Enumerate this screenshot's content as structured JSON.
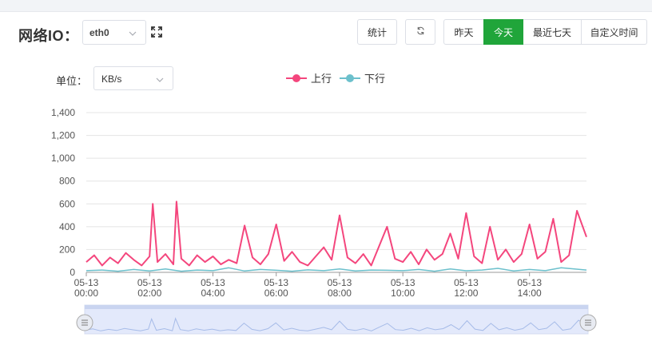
{
  "header": {
    "title": "网络IO："
  },
  "interface_select": {
    "value": "eth0",
    "icon": "chevron-down-icon"
  },
  "expand_icon": "expand-icon",
  "toolbar": {
    "stats_label": "统计",
    "refresh_icon": "refresh-icon",
    "ranges": [
      {
        "label": "昨天",
        "active": false
      },
      {
        "label": "今天",
        "active": true
      },
      {
        "label": "最近七天",
        "active": false
      },
      {
        "label": "自定义时间",
        "active": false
      }
    ]
  },
  "unit": {
    "label": "单位：",
    "value": "KB/s"
  },
  "colors": {
    "upload": "#f4467d",
    "download": "#6cc0cc",
    "accent": "#20a53a",
    "zoom_fill": "#e3e9fb",
    "zoom_line": "#a6bbe8"
  },
  "chart_data": {
    "type": "line",
    "ylim": [
      0,
      1400
    ],
    "yticks": [
      "1,400",
      "1,200",
      "1,000",
      "800",
      "600",
      "400",
      "200",
      "0"
    ],
    "xticks": [
      {
        "d": "05-13",
        "t": "00:00"
      },
      {
        "d": "05-13",
        "t": "02:00"
      },
      {
        "d": "05-13",
        "t": "04:00"
      },
      {
        "d": "05-13",
        "t": "06:00"
      },
      {
        "d": "05-13",
        "t": "08:00"
      },
      {
        "d": "05-13",
        "t": "10:00"
      },
      {
        "d": "05-13",
        "t": "12:00"
      },
      {
        "d": "05-13",
        "t": "14:00"
      }
    ],
    "x_range_hours": [
      0,
      15.8
    ],
    "series": [
      {
        "name": "上行",
        "x": [
          0,
          0.25,
          0.5,
          0.75,
          1,
          1.25,
          1.5,
          1.75,
          2,
          2.1,
          2.25,
          2.5,
          2.75,
          2.85,
          3,
          3.25,
          3.5,
          3.75,
          4,
          4.25,
          4.5,
          4.75,
          5,
          5.25,
          5.5,
          5.75,
          6,
          6.25,
          6.5,
          6.75,
          7,
          7.25,
          7.5,
          7.75,
          8,
          8.25,
          8.5,
          8.75,
          9,
          9.25,
          9.5,
          9.75,
          10,
          10.25,
          10.5,
          10.75,
          11,
          11.25,
          11.5,
          11.75,
          12,
          12.25,
          12.5,
          12.75,
          13,
          13.25,
          13.5,
          13.75,
          14,
          14.25,
          14.5,
          14.75,
          15,
          15.25,
          15.5,
          15.8
        ],
        "values": [
          90,
          150,
          60,
          130,
          80,
          170,
          110,
          60,
          140,
          600,
          90,
          160,
          70,
          620,
          120,
          60,
          150,
          90,
          140,
          70,
          110,
          80,
          410,
          130,
          70,
          160,
          420,
          100,
          180,
          90,
          60,
          140,
          220,
          110,
          500,
          130,
          80,
          160,
          60,
          230,
          400,
          120,
          90,
          180,
          70,
          200,
          110,
          160,
          340,
          120,
          520,
          140,
          80,
          400,
          110,
          200,
          90,
          160,
          420,
          120,
          180,
          470,
          90,
          150,
          540,
          310
        ]
      },
      {
        "name": "下行",
        "x": [
          0,
          0.5,
          1,
          1.5,
          2,
          2.5,
          3,
          3.5,
          4,
          4.5,
          5,
          5.5,
          6,
          6.5,
          7,
          7.5,
          8,
          8.5,
          9,
          9.5,
          10,
          10.5,
          11,
          11.5,
          12,
          12.5,
          13,
          13.5,
          14,
          14.5,
          15,
          15.8
        ],
        "values": [
          15,
          20,
          10,
          25,
          12,
          30,
          10,
          20,
          15,
          40,
          12,
          25,
          18,
          10,
          22,
          15,
          30,
          12,
          20,
          18,
          15,
          25,
          10,
          30,
          14,
          20,
          35,
          12,
          25,
          15,
          40,
          20
        ]
      }
    ]
  }
}
